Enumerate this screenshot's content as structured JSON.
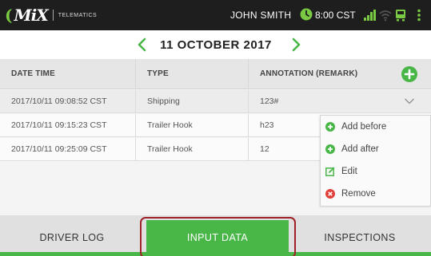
{
  "app": {
    "logo_mark": "MiX",
    "logo_subtitle": "TELEMATICS"
  },
  "status_bar": {
    "user_name": "JOHN SMITH",
    "time": "8:00 CST",
    "icons": [
      "clock-icon",
      "signal-icon",
      "wifi-icon",
      "truck-icon",
      "menu-icon"
    ],
    "accent_color": "#7ac943"
  },
  "date_nav": {
    "date": "11 OCTOBER 2017",
    "prev_icon": "chevron-left-icon",
    "next_icon": "chevron-right-icon"
  },
  "table": {
    "headers": {
      "date_time": "DATE TIME",
      "type": "TYPE",
      "annotation": "ANNOTATION (REMARK)"
    },
    "rows": [
      {
        "date_time": "2017/10/11 09:08:52 CST",
        "type": "Shipping",
        "annotation": "123#"
      },
      {
        "date_time": "2017/10/11 09:15:23 CST",
        "type": "Trailer Hook",
        "annotation": "h23"
      },
      {
        "date_time": "2017/10/11 09:25:09 CST",
        "type": "Trailer Hook",
        "annotation": "12"
      }
    ]
  },
  "context_menu": {
    "items": [
      {
        "label": "Add before",
        "icon": "plus-circle-icon",
        "color": "#49b648"
      },
      {
        "label": "Add after",
        "icon": "plus-circle-icon",
        "color": "#49b648"
      },
      {
        "label": "Edit",
        "icon": "edit-icon",
        "color": "#49b648"
      },
      {
        "label": "Remove",
        "icon": "remove-circle-icon",
        "color": "#e0413a"
      }
    ]
  },
  "tabs": {
    "items": [
      {
        "label": "DRIVER LOG",
        "active": false
      },
      {
        "label": "INPUT DATA",
        "active": true
      },
      {
        "label": "INSPECTIONS",
        "active": false
      }
    ],
    "active_color": "#49b648",
    "highlight_color": "#a0222a"
  }
}
